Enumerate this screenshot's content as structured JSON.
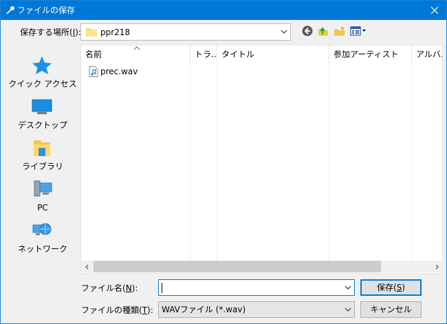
{
  "window": {
    "title": "ファイルの保存",
    "title_color": "#0078d7"
  },
  "location": {
    "label_prefix": "保存する場所(",
    "label_key": "I",
    "label_suffix": "):",
    "folder_name": "ppr218"
  },
  "toolbar": {
    "back_icon": "back-icon",
    "up_icon": "up-folder-icon",
    "new_folder_icon": "new-folder-icon",
    "view_menu_icon": "view-menu-icon"
  },
  "places": [
    {
      "label": "クイック アクセス",
      "icon": "quick-access-star-icon"
    },
    {
      "label": "デスクトップ",
      "icon": "desktop-icon"
    },
    {
      "label": "ライブラリ",
      "icon": "library-icon"
    },
    {
      "label": "PC",
      "icon": "pc-icon"
    },
    {
      "label": "ネットワーク",
      "icon": "network-icon"
    }
  ],
  "columns": [
    "名前",
    "トラ...",
    "タイトル",
    "参加アーティスト",
    "アルバム"
  ],
  "files": [
    {
      "name": "prec.wav",
      "icon": "audio-file-icon"
    }
  ],
  "filename_field": {
    "label_prefix": "ファイル名(",
    "label_key": "N",
    "label_suffix": "):",
    "value": ""
  },
  "filetype_field": {
    "label_prefix": "ファイルの種類(",
    "label_key": "T",
    "label_suffix": "):",
    "value": "WAVファイル (*.wav)"
  },
  "buttons": {
    "save_prefix": "保存(",
    "save_key": "S",
    "save_suffix": ")",
    "cancel": "キャンセル"
  }
}
